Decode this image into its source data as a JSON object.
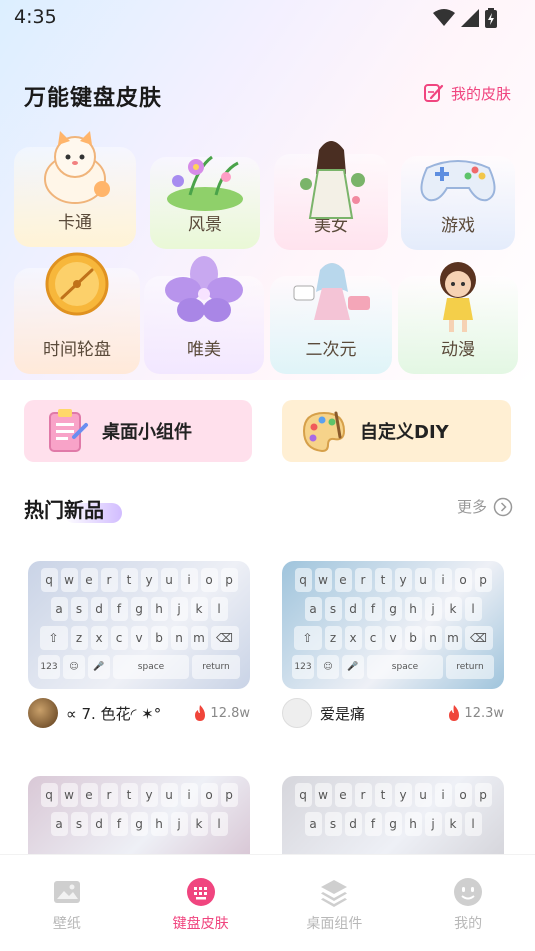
{
  "status_bar": {
    "time": "4:35"
  },
  "header": {
    "title": "万能键盘皮肤",
    "my_skins": "我的皮肤"
  },
  "categories": [
    {
      "label": "卡通",
      "icon": "cartoon-cat-icon",
      "bg": "#fff3d6"
    },
    {
      "label": "风景",
      "icon": "landscape-flowers-icon",
      "bg": "#e9f8d6"
    },
    {
      "label": "美女",
      "icon": "beauty-girl-icon",
      "bg": "#ffe3ee"
    },
    {
      "label": "游戏",
      "icon": "gamepad-icon",
      "bg": "#e4ecfb"
    },
    {
      "label": "时间轮盘",
      "icon": "time-wheel-icon",
      "bg": "#ffe9d9"
    },
    {
      "label": "唯美",
      "icon": "aesthetic-flower-icon",
      "bg": "#f2e7ff"
    },
    {
      "label": "二次元",
      "icon": "anime-girl-icon",
      "bg": "#dff4f8"
    },
    {
      "label": "动漫",
      "icon": "cartoon-doll-icon",
      "bg": "#e3f7e3"
    }
  ],
  "shortcuts": [
    {
      "label": "桌面小组件",
      "icon": "clipboard-icon",
      "bg": "#ffe0ec"
    },
    {
      "label": "自定义DIY",
      "icon": "palette-icon",
      "bg": "#ffefd3"
    }
  ],
  "hot_section": {
    "title": "热门新品",
    "more": "更多"
  },
  "keyboard": {
    "row1": [
      "q",
      "w",
      "e",
      "r",
      "t",
      "y",
      "u",
      "i",
      "o",
      "p"
    ],
    "row2": [
      "a",
      "s",
      "d",
      "f",
      "g",
      "h",
      "j",
      "k",
      "l"
    ],
    "row3": [
      "z",
      "x",
      "c",
      "v",
      "b",
      "n",
      "m"
    ],
    "num_key": "123",
    "space_key": "space",
    "return_key": "return"
  },
  "products": [
    {
      "name": "∝ 7. 色花◜ ✶°",
      "hot": "12.8w",
      "theme": "#c9d3e6"
    },
    {
      "name": "爱是痛",
      "hot": "12.3w",
      "theme": "#9fc4dc"
    },
    {
      "name": "",
      "hot": "",
      "theme": "#d9c8d6"
    },
    {
      "name": "",
      "hot": "",
      "theme": "#d6d6dc"
    }
  ],
  "bottom_nav": [
    {
      "label": "壁纸",
      "icon": "wallpaper-icon",
      "active": false
    },
    {
      "label": "键盘皮肤",
      "icon": "keyboard-icon",
      "active": true
    },
    {
      "label": "桌面组件",
      "icon": "layers-icon",
      "active": false
    },
    {
      "label": "我的",
      "icon": "profile-face-icon",
      "active": false
    }
  ],
  "colors": {
    "accent": "#f0457f",
    "muted": "#b8b8b8"
  }
}
